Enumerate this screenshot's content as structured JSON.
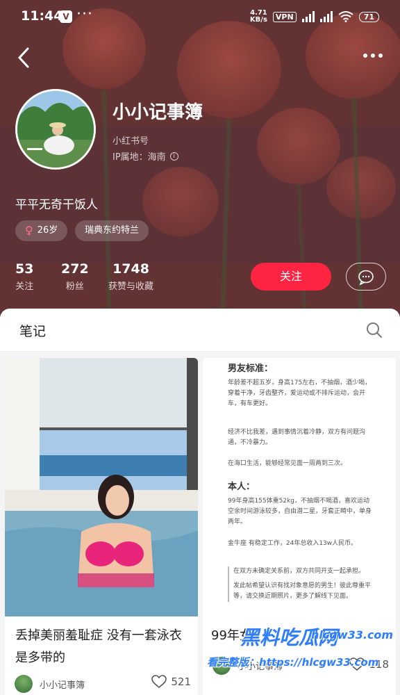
{
  "status_bar": {
    "time": "11:44",
    "app_badge": "V",
    "overflow": "···",
    "speed_value": "4.71",
    "speed_unit": "KB/s",
    "vpn": "VPN",
    "battery": "71"
  },
  "profile": {
    "name": "小小记事簿",
    "id_line": "小红书号",
    "ip_line": "IP属地：海南",
    "bio": "平平无奇干饭人",
    "age_tag": "26岁",
    "location_tag": "瑞典东约特兰",
    "stats": [
      {
        "num": "53",
        "label": "关注"
      },
      {
        "num": "272",
        "label": "粉丝"
      },
      {
        "num": "1748",
        "label": "获赞与收藏"
      }
    ],
    "follow_label": "关注"
  },
  "content": {
    "tab_label": "笔记",
    "cards": [
      {
        "title": "丢掉美丽羞耻症 没有一套泳衣是多带的",
        "author": "小小记事簿",
        "likes": "521"
      },
      {
        "title": "99年女",
        "author": "小小记事簿",
        "likes": "118",
        "doc": {
          "h1": "男友标准：",
          "p1": "年龄差不超五岁，身高175左右，不抽烟，酒少喝，穿着干净，牙齿整齐，爱运动或不排斥运动，会开车，有车更好。",
          "p2": "经济不比我差，遇到事情沉着冷静，双方有问题沟通，不冷暴力。",
          "p3": "在海口生活，能够经常见面一周两到三次。",
          "h2": "本人：",
          "p4": "99年身高155体重52kg，不抽烟不喝酒，喜欢运动空余时间游泳较多，自由潜二星，牙套正畸中，单身两年。",
          "p5": "金牛座 有稳定工作，24年总收入13w人民币。",
          "p6": "在双方未确定关系前，双方共同开支一起承担。",
          "p7": "发此帖希望认识有找对象意愿的男生！彼此尊重平等，请交换近期照片，更多了解线下见面。"
        }
      }
    ]
  },
  "watermark": {
    "brand": "黑料吃瓜网",
    "site": "hlcgw33.com",
    "line": "看完整版：https://hlcgw33.com"
  },
  "colors": {
    "accent": "#ff2442",
    "hero": "#6f3b3b",
    "watermark": "#2f7dff"
  }
}
